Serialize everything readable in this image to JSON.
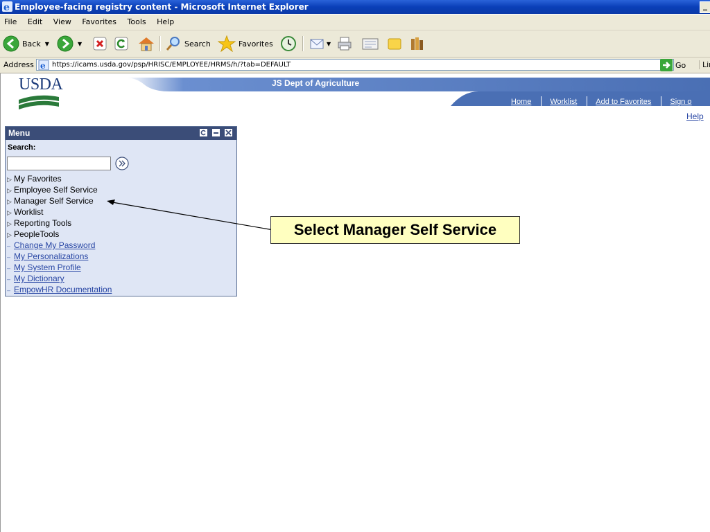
{
  "window": {
    "title": "Employee-facing registry content - Microsoft Internet Explorer",
    "min_glyph": "_"
  },
  "menubar": [
    "File",
    "Edit",
    "View",
    "Favorites",
    "Tools",
    "Help"
  ],
  "toolbar": {
    "back_label": "Back",
    "search_label": "Search",
    "favorites_label": "Favorites"
  },
  "address": {
    "label": "Address",
    "url": "https://icams.usda.gov/psp/HRISC/EMPLOYEE/HRMS/h/?tab=DEFAULT",
    "go_label": "Go",
    "links_label": "Lir"
  },
  "page": {
    "logo_text": "USDA",
    "banner_title": "JS Dept of Agriculture",
    "nav_links": [
      "Home",
      "Worklist",
      "Add to Favorites",
      "Sign o"
    ],
    "help_link": "Help"
  },
  "menu": {
    "title": "Menu",
    "search_label": "Search:",
    "search_value": "",
    "items": [
      {
        "label": "My Favorites",
        "kind": "folder"
      },
      {
        "label": "Employee Self Service",
        "kind": "folder"
      },
      {
        "label": "Manager Self Service",
        "kind": "folder"
      },
      {
        "label": "Worklist",
        "kind": "folder"
      },
      {
        "label": "Reporting Tools",
        "kind": "folder"
      },
      {
        "label": "PeopleTools",
        "kind": "folder"
      },
      {
        "label": "Change My Password",
        "kind": "link"
      },
      {
        "label": "My Personalizations",
        "kind": "link"
      },
      {
        "label": "My System Profile",
        "kind": "link"
      },
      {
        "label": "My Dictionary",
        "kind": "link"
      },
      {
        "label": "EmpowHR Documentation",
        "kind": "link"
      }
    ]
  },
  "callout": {
    "text": "Select Manager Self Service"
  },
  "colors": {
    "title_bar": "#0a3fb8",
    "chrome": "#ece9d8",
    "banner_blue": "#4a6fb4",
    "menu_header": "#3b4d78",
    "menu_bg": "#dfe6f5",
    "link": "#2846a4",
    "callout_bg": "#ffffc0"
  }
}
